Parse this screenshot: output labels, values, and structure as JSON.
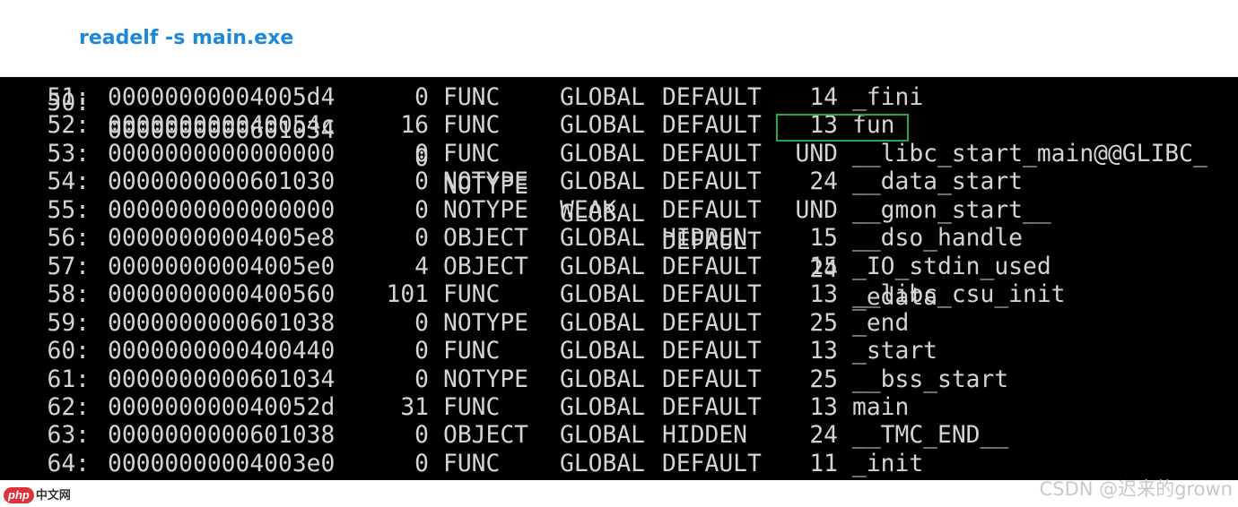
{
  "header": {
    "command": "readelf -s main.exe"
  },
  "terminal": {
    "partial_top_row": {
      "num": "50:",
      "value": "0000000000601034",
      "size": "0",
      "type": "NOTYPE",
      "bind": "GLOBAL",
      "vis": "DEFAULT",
      "ndx": "24",
      "name": "_edata"
    },
    "rows": [
      {
        "num": "51:",
        "value": "00000000004005d4",
        "size": "0",
        "type": "FUNC",
        "bind": "GLOBAL",
        "vis": "DEFAULT",
        "ndx": "14",
        "name": "_fini"
      },
      {
        "num": "52:",
        "value": "000000000040054c",
        "size": "16",
        "type": "FUNC",
        "bind": "GLOBAL",
        "vis": "DEFAULT",
        "ndx": "13",
        "name": "fun"
      },
      {
        "num": "53:",
        "value": "0000000000000000",
        "size": "0",
        "type": "FUNC",
        "bind": "GLOBAL",
        "vis": "DEFAULT",
        "ndx": "UND",
        "name": "__libc_start_main@@GLIBC_"
      },
      {
        "num": "54:",
        "value": "0000000000601030",
        "size": "0",
        "type": "NOTYPE",
        "bind": "GLOBAL",
        "vis": "DEFAULT",
        "ndx": "24",
        "name": "__data_start"
      },
      {
        "num": "55:",
        "value": "0000000000000000",
        "size": "0",
        "type": "NOTYPE",
        "bind": "WEAK",
        "vis": "DEFAULT",
        "ndx": "UND",
        "name": "__gmon_start__"
      },
      {
        "num": "56:",
        "value": "00000000004005e8",
        "size": "0",
        "type": "OBJECT",
        "bind": "GLOBAL",
        "vis": "HIDDEN",
        "ndx": "15",
        "name": "__dso_handle"
      },
      {
        "num": "57:",
        "value": "00000000004005e0",
        "size": "4",
        "type": "OBJECT",
        "bind": "GLOBAL",
        "vis": "DEFAULT",
        "ndx": "15",
        "name": "_IO_stdin_used"
      },
      {
        "num": "58:",
        "value": "0000000000400560",
        "size": "101",
        "type": "FUNC",
        "bind": "GLOBAL",
        "vis": "DEFAULT",
        "ndx": "13",
        "name": "__libc_csu_init"
      },
      {
        "num": "59:",
        "value": "0000000000601038",
        "size": "0",
        "type": "NOTYPE",
        "bind": "GLOBAL",
        "vis": "DEFAULT",
        "ndx": "25",
        "name": "_end"
      },
      {
        "num": "60:",
        "value": "0000000000400440",
        "size": "0",
        "type": "FUNC",
        "bind": "GLOBAL",
        "vis": "DEFAULT",
        "ndx": "13",
        "name": "_start"
      },
      {
        "num": "61:",
        "value": "0000000000601034",
        "size": "0",
        "type": "NOTYPE",
        "bind": "GLOBAL",
        "vis": "DEFAULT",
        "ndx": "25",
        "name": "__bss_start"
      },
      {
        "num": "62:",
        "value": "000000000040052d",
        "size": "31",
        "type": "FUNC",
        "bind": "GLOBAL",
        "vis": "DEFAULT",
        "ndx": "13",
        "name": "main"
      },
      {
        "num": "63:",
        "value": "0000000000601038",
        "size": "0",
        "type": "OBJECT",
        "bind": "GLOBAL",
        "vis": "HIDDEN",
        "ndx": "24",
        "name": "__TMC_END__"
      },
      {
        "num": "64:",
        "value": "00000000004003e0",
        "size": "0",
        "type": "FUNC",
        "bind": "GLOBAL",
        "vis": "DEFAULT",
        "ndx": "11",
        "name": "_init"
      }
    ],
    "highlighted_symbol": "fun",
    "highlight_color": "#2aa54a",
    "text_color": "#d4d4d4",
    "background_color": "#000000"
  },
  "footer": {
    "logo_badge": "php",
    "logo_text": "中文网",
    "watermark": "CSDN @迟来的grown"
  }
}
